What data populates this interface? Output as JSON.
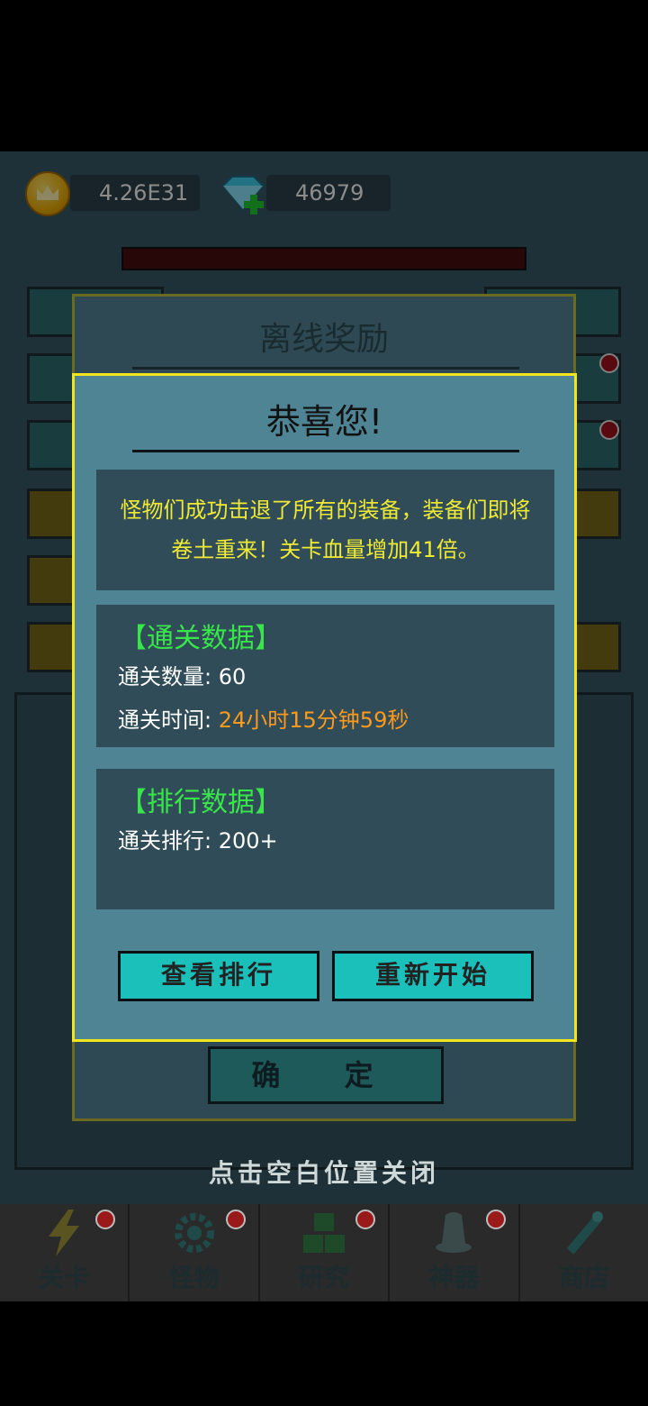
{
  "currency": {
    "gold": "4.26E31",
    "gems": "46979",
    "gold_icon": "crown-coin-icon",
    "gem_icon": "diamond-plus-icon"
  },
  "back_dialog": {
    "title": "离线奖励",
    "confirm": "确 定"
  },
  "dialog": {
    "title": "恭喜您!",
    "message_line1": "怪物们成功击退了所有的装备，装备们即将",
    "message_line2": "卷土重来！关卡血量增加41倍。",
    "stats": {
      "title": "【通关数据】",
      "count_label": "通关数量: ",
      "count_value": "60",
      "time_label": "通关时间: ",
      "time_value": "24小时15分钟59秒"
    },
    "rank": {
      "title": "【排行数据】",
      "rank_label": "通关排行: ",
      "rank_value": "200+"
    },
    "buttons": {
      "view_rank": "查看排行",
      "restart": "重新开始"
    }
  },
  "hint": "点击空白位置关闭",
  "nav": {
    "items": [
      {
        "label": "关卡",
        "icon": "lightning-icon"
      },
      {
        "label": "怪物",
        "icon": "gear-icon"
      },
      {
        "label": "研究",
        "icon": "cubes-icon"
      },
      {
        "label": "神器",
        "icon": "bell-icon"
      },
      {
        "label": "商店",
        "icon": "wand-icon"
      }
    ]
  },
  "colors": {
    "dialog_bg": "#4f8494",
    "dialog_border": "#f3e51c",
    "panel_bg": "#2f4c58",
    "message_text": "#f0ea34",
    "section_title": "#38e64a",
    "time_value": "#ff9a1e",
    "button": "#1cc0ba"
  }
}
